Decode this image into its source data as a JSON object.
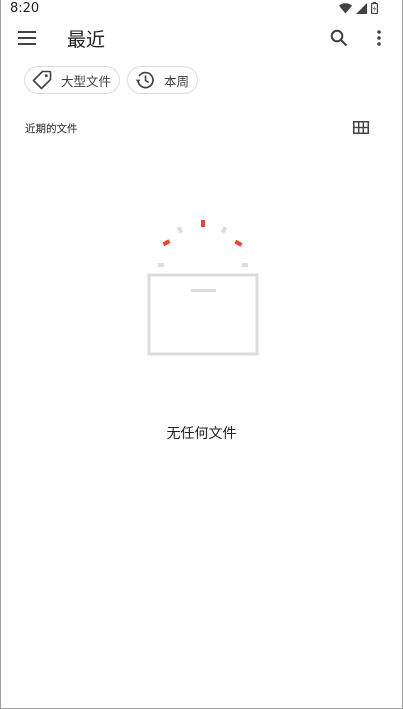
{
  "status_bar": {
    "time": "8:20",
    "icons": [
      "wifi-icon",
      "signal-icon",
      "battery-icon"
    ]
  },
  "app_bar": {
    "title": "最近",
    "menu_icon": "hamburger-menu-icon",
    "search_icon": "search-icon",
    "more_icon": "more-vert-icon"
  },
  "chips": [
    {
      "label": "大型文件",
      "icon": "tag-icon"
    },
    {
      "label": "本周",
      "icon": "history-icon"
    }
  ],
  "section": {
    "title": "近期的文件",
    "view_toggle_icon": "grid-view-icon"
  },
  "empty_state": {
    "message": "无任何文件",
    "accent_color": "#ea4335",
    "neutral_color": "#dadce0"
  }
}
